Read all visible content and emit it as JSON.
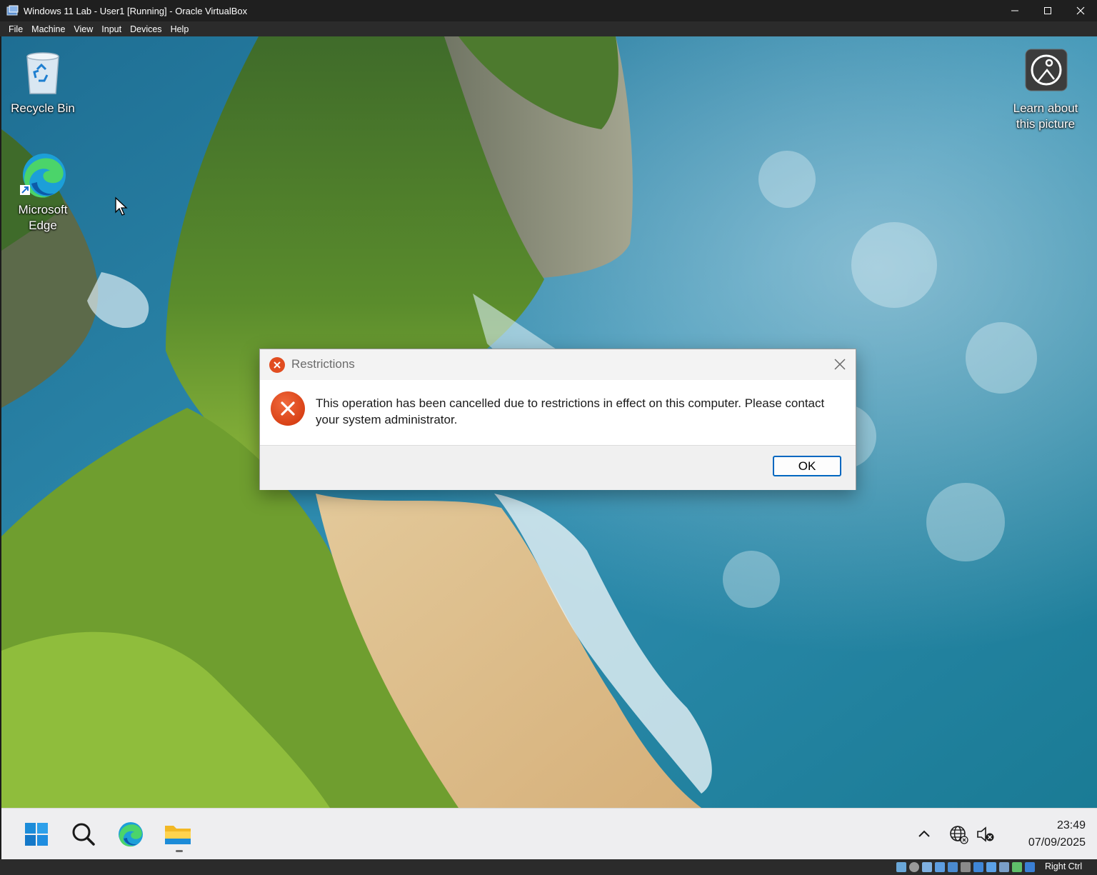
{
  "vbox": {
    "title": "Windows 11 Lab - User1 [Running] - Oracle VirtualBox",
    "menu": [
      "File",
      "Machine",
      "View",
      "Input",
      "Devices",
      "Help"
    ],
    "host_key": "Right Ctrl",
    "status_icons": [
      "hard-disk-icon",
      "optical-drive-icon",
      "audio-icon",
      "network-icon",
      "usb-icon",
      "shared-folders-icon",
      "display-icon",
      "recording-icon",
      "cpu-icon",
      "mouse-integration-icon",
      "keyboard-icon"
    ]
  },
  "desktop": {
    "icons": [
      {
        "label": "Recycle Bin",
        "icon": "recycle-bin-icon"
      },
      {
        "label": "Microsoft Edge",
        "icon": "edge-icon"
      },
      {
        "label": "Learn about this picture",
        "icon": "learn-about-picture-icon"
      }
    ]
  },
  "dialog": {
    "title": "Restrictions",
    "message": "This operation has been cancelled due to restrictions in effect on this computer. Please contact your system administrator.",
    "ok_label": "OK",
    "colors": {
      "error": "#e14d20",
      "button_border": "#0067c0"
    }
  },
  "taskbar": {
    "pinned": [
      "start-icon",
      "search-icon",
      "edge-icon",
      "file-explorer-icon"
    ],
    "tray": [
      "show-hidden-icons-chevron",
      "network-globe-icon",
      "speaker-muted-icon"
    ],
    "time": "23:49",
    "date": "07/09/2025"
  }
}
